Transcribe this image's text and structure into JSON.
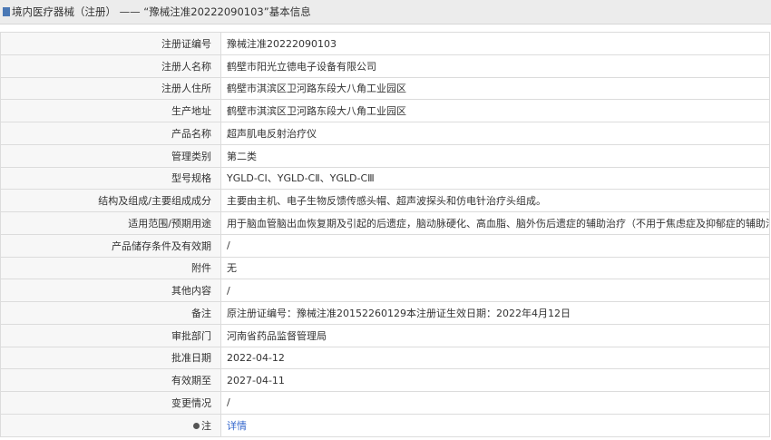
{
  "header": {
    "title": "境内医疗器械（注册） —— “豫械注准20222090103”基本信息"
  },
  "rows": [
    {
      "label": "注册证编号",
      "value": "豫械注准20222090103"
    },
    {
      "label": "注册人名称",
      "value": "鹤壁市阳光立德电子设备有限公司"
    },
    {
      "label": "注册人住所",
      "value": "鹤壁市淇滨区卫河路东段大八角工业园区"
    },
    {
      "label": "生产地址",
      "value": "鹤壁市淇滨区卫河路东段大八角工业园区"
    },
    {
      "label": "产品名称",
      "value": "超声肌电反射治疗仪"
    },
    {
      "label": "管理类别",
      "value": "第二类"
    },
    {
      "label": "型号规格",
      "value": "YGLD-CⅠ、YGLD-CⅡ、YGLD-CⅢ"
    },
    {
      "label": "结构及组成/主要组成成分",
      "value": "主要由主机、电子生物反馈传感头帽、超声波探头和仿电针治疗头组成。"
    },
    {
      "label": "适用范围/预期用途",
      "value": "用于脑血管脑出血恢复期及引起的后遗症，脑动脉硬化、高血脂、脑外伤后遗症的辅助治疗（不用于焦虑症及抑郁症的辅助治疗）。"
    },
    {
      "label": "产品储存条件及有效期",
      "value": "/"
    },
    {
      "label": "附件",
      "value": "无"
    },
    {
      "label": "其他内容",
      "value": "/"
    },
    {
      "label": "备注",
      "value": "原注册证编号：豫械注准20152260129本注册证生效日期：2022年4月12日"
    },
    {
      "label": "审批部门",
      "value": "河南省药品监督管理局"
    },
    {
      "label": "批准日期",
      "value": "2022-04-12"
    },
    {
      "label": "有效期至",
      "value": "2027-04-11"
    },
    {
      "label": "变更情况",
      "value": "/"
    }
  ],
  "note": {
    "label": "注",
    "link": "详情"
  }
}
